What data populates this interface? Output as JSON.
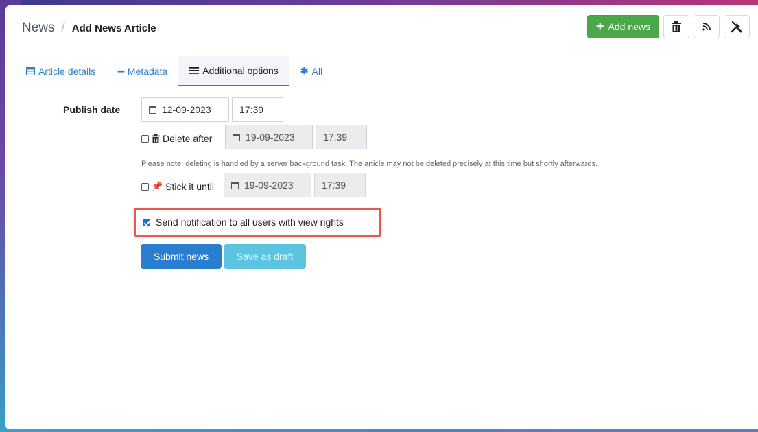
{
  "breadcrumb": {
    "root": "News",
    "separator": "/",
    "current": "Add News Article"
  },
  "header_actions": {
    "add_news_label": "Add news",
    "icons": [
      "trash-icon",
      "rss-icon",
      "tools-icon"
    ]
  },
  "tabs": [
    {
      "label": "Article details",
      "icon": "table-icon",
      "active": false
    },
    {
      "label": "Metadata",
      "icon": "dots-icon",
      "active": false
    },
    {
      "label": "Additional options",
      "icon": "list-icon",
      "active": true
    },
    {
      "label": "All",
      "icon": "asterisk-icon",
      "active": false
    }
  ],
  "form": {
    "publish_label": "Publish date",
    "publish_date": "12-09-2023",
    "publish_time": "17:39",
    "delete_after": {
      "label": "Delete after",
      "checked": false,
      "date": "19-09-2023",
      "time": "17:39"
    },
    "delete_note": "Please note, deleting is handled by a server background task. The article may not be deleted precisely at this time but shortly afterwards.",
    "stick_until": {
      "label": "Stick it until",
      "checked": false,
      "date": "19-09-2023",
      "time": "17:39"
    },
    "notify": {
      "label": "Send notification to all users with view rights",
      "checked": true
    },
    "submit_label": "Submit news",
    "draft_label": "Save as draft"
  },
  "colors": {
    "primary": "#2a7ed0",
    "success": "#4aa84a",
    "info": "#5cc4e0",
    "highlight": "#e55a4e"
  }
}
